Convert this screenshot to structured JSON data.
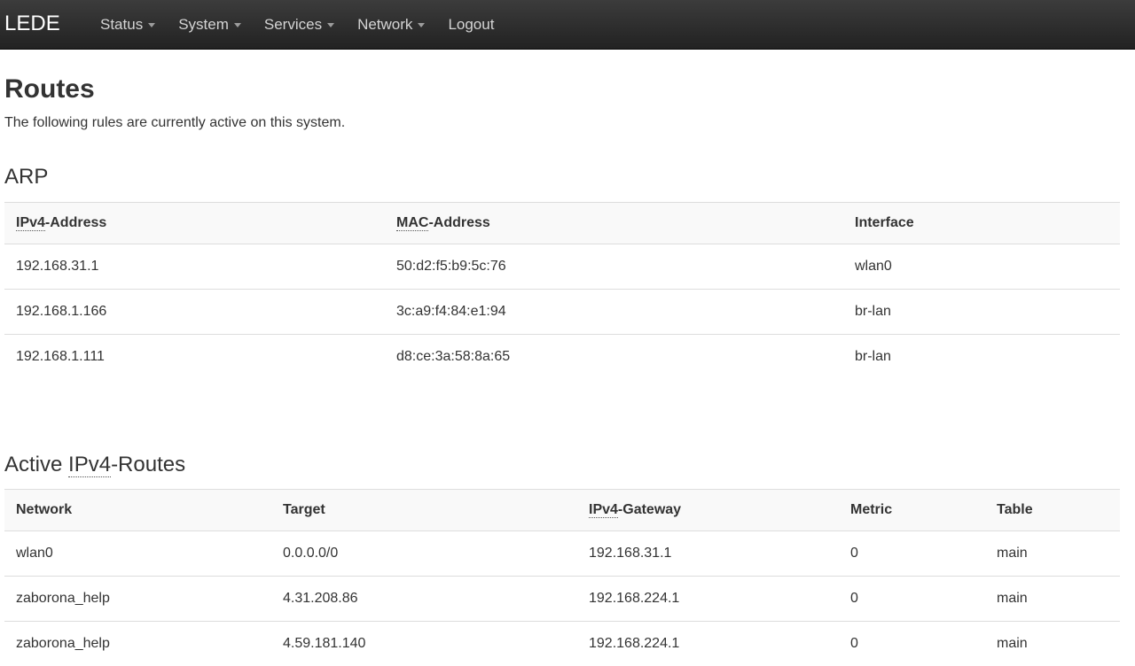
{
  "navbar": {
    "brand": "LEDE",
    "menu": [
      {
        "label": "Status",
        "dropdown": true
      },
      {
        "label": "System",
        "dropdown": true
      },
      {
        "label": "Services",
        "dropdown": true
      },
      {
        "label": "Network",
        "dropdown": true
      },
      {
        "label": "Logout",
        "dropdown": false
      }
    ]
  },
  "page": {
    "title": "Routes",
    "description": "The following rules are currently active on this system."
  },
  "arp": {
    "title": "ARP",
    "headers": {
      "ipv4_abbr": "IPv4",
      "ipv4_rest": "-Address",
      "mac_abbr": "MAC",
      "mac_rest": "-Address",
      "interface": "Interface"
    },
    "rows": [
      {
        "ip": "192.168.31.1",
        "mac": "50:d2:f5:b9:5c:76",
        "iface": "wlan0"
      },
      {
        "ip": "192.168.1.166",
        "mac": "3c:a9:f4:84:e1:94",
        "iface": "br-lan"
      },
      {
        "ip": "192.168.1.111",
        "mac": "d8:ce:3a:58:8a:65",
        "iface": "br-lan"
      }
    ]
  },
  "routes": {
    "title_prefix": "Active ",
    "title_abbr": "IPv4",
    "title_suffix": "-Routes",
    "headers": {
      "network": "Network",
      "target": "Target",
      "gateway_abbr": "IPv4",
      "gateway_rest": "-Gateway",
      "metric": "Metric",
      "table": "Table"
    },
    "rows": [
      {
        "network": "wlan0",
        "target": "0.0.0.0/0",
        "gateway": "192.168.31.1",
        "metric": "0",
        "table": "main"
      },
      {
        "network": "zaborona_help",
        "target": "4.31.208.86",
        "gateway": "192.168.224.1",
        "metric": "0",
        "table": "main"
      },
      {
        "network": "zaborona_help",
        "target": "4.59.181.140",
        "gateway": "192.168.224.1",
        "metric": "0",
        "table": "main"
      }
    ]
  }
}
